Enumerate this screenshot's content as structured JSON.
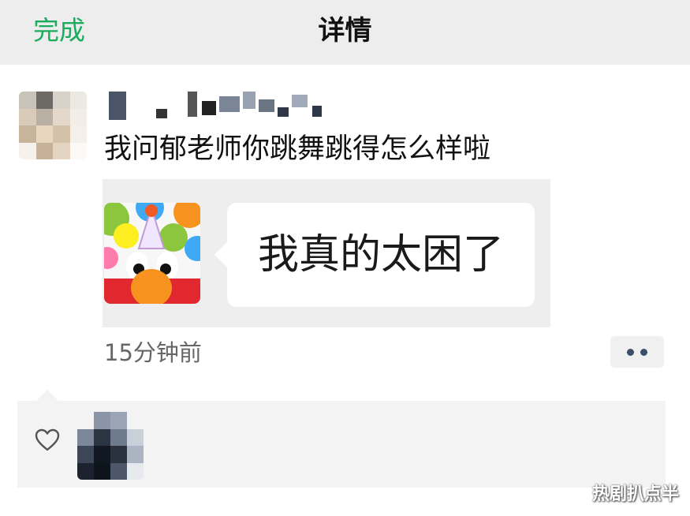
{
  "navbar": {
    "done_label": "完成",
    "title": "详情"
  },
  "post": {
    "text": "我问郁老师你跳舞跳得怎么样啦",
    "sticker_caption": "我真的太困了",
    "timestamp": "15分钟前",
    "more_icon": "ellipsis-icon"
  },
  "likes": {
    "icon": "heart-icon"
  },
  "watermark": "热剧扒点半",
  "colors": {
    "navbar_bg": "#ededed",
    "done_green": "#1aad5e",
    "more_dots": "#3b4f6b",
    "likes_bg": "#f3f3f3"
  }
}
